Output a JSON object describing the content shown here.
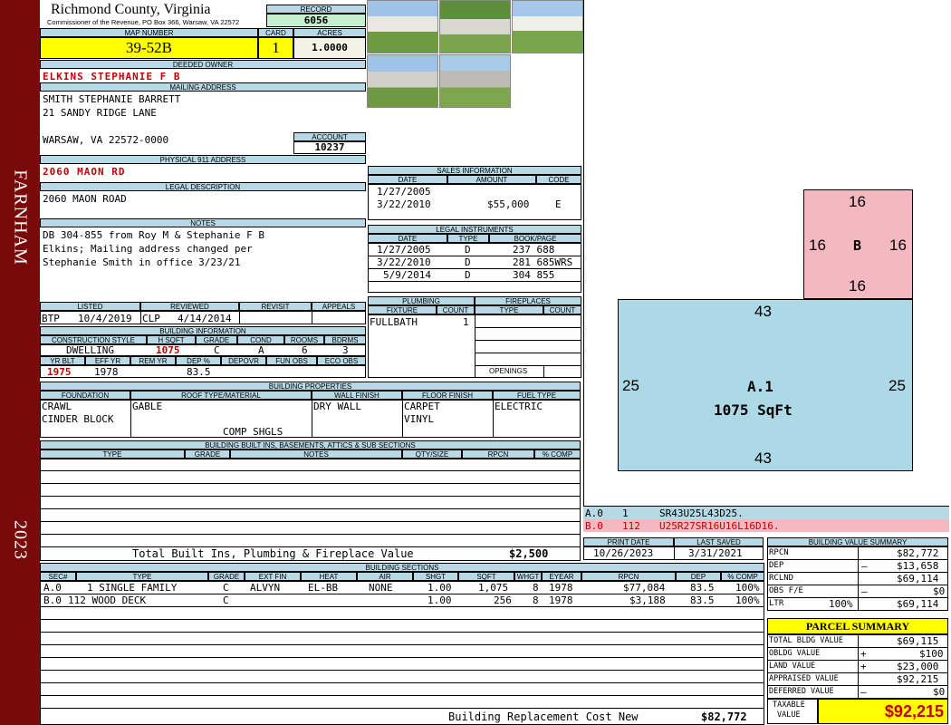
{
  "sidebar": {
    "locality": "FARNHAM",
    "year": "2023"
  },
  "header": {
    "county": "Richmond County, Virginia",
    "commissioner": "Commissioner of the Revenue, PO Box 366, Warsaw, VA 22572",
    "record_label": "RECORD",
    "record": "6056",
    "map_label": "MAP NUMBER",
    "map": "39-52B",
    "card_label": "CARD",
    "card": "1",
    "acres_label": "ACRES",
    "acres": "1.0000"
  },
  "owner": {
    "label": "DEEDED OWNER",
    "name": "ELKINS STEPHANIE F B",
    "mail_label": "MAILING ADDRESS",
    "mail1": "SMITH STEPHANIE BARRETT",
    "mail2": "21 SANDY RIDGE LANE",
    "mail3": "WARSAW, VA 22572-0000",
    "account_label": "ACCOUNT",
    "account": "10237"
  },
  "physical": {
    "label": "PHYSICAL 911 ADDRESS",
    "value": "2060 MAON RD"
  },
  "legal": {
    "label": "LEGAL DESCRIPTION",
    "value": "2060 MAON ROAD"
  },
  "notes": {
    "label": "NOTES",
    "line1": "DB 304-855 from Roy M & Stephanie F B",
    "line2": "Elkins; Mailing address changed per",
    "line3": "Stephanie Smith in office 3/23/21"
  },
  "review": {
    "listed_label": "LISTED",
    "reviewed_label": "REVIEWED",
    "revisit_label": "REVISIT",
    "appeals_label": "APPEALS",
    "listed_by": "BTP",
    "listed_date": "10/4/2019",
    "reviewed_by": "CLP",
    "reviewed_date": "4/14/2014"
  },
  "building": {
    "label": "BUILDING INFORMATION",
    "h_style": "CONSTRUCTION STYLE",
    "h_sqft": "H SQFT",
    "h_grade": "GRADE",
    "h_cond": "COND",
    "h_rooms": "ROOMS",
    "h_bdrms": "BDRMS",
    "style": "DWELLING",
    "sqft": "1075",
    "grade": "C",
    "cond": "A",
    "rooms": "6",
    "bdrms": "3",
    "h_yrblt": "YR BLT",
    "h_effyr": "EFF YR",
    "h_remyr": "REM YR",
    "h_dep": "DEP %",
    "h_depovr": "DEPOVR",
    "h_funobs": "FUN OBS",
    "h_ecoobs": "ECO OBS",
    "yrblt": "1975",
    "effyr": "1978",
    "dep": "83.5"
  },
  "props": {
    "label": "BUILDING PROPERTIES",
    "h_found": "FOUNDATION",
    "h_roof": "ROOF TYPE/MATERIAL",
    "h_wall": "WALL FINISH",
    "h_floor": "FLOOR FINISH",
    "h_fuel": "FUEL TYPE",
    "found1": "CRAWL",
    "found2": "CINDER BLOCK",
    "roof1": "GABLE",
    "roof2": "COMP SHGLS",
    "wall": "DRY WALL",
    "floor1": "CARPET",
    "floor2": "VINYL",
    "fuel": "ELECTRIC"
  },
  "sales": {
    "label": "SALES INFORMATION",
    "h_date": "DATE",
    "h_amount": "AMOUNT",
    "h_code": "CODE",
    "rows": [
      {
        "date": "1/27/2005",
        "amount": "",
        "code": ""
      },
      {
        "date": "3/22/2010",
        "amount": "$55,000",
        "code": "E"
      }
    ]
  },
  "instruments": {
    "label": "LEGAL INSTRUMENTS",
    "h_date": "DATE",
    "h_type": "TYPE",
    "h_book": "BOOK/PAGE",
    "rows": [
      {
        "date": "1/27/2005",
        "type": "D",
        "book": "237 688"
      },
      {
        "date": "3/22/2010",
        "type": "D",
        "book": "281 685WRS"
      },
      {
        "date": "5/9/2014",
        "type": "D",
        "book": "304 855"
      }
    ]
  },
  "plumbing": {
    "label": "PLUMBING",
    "h_fixture": "FIXTURE",
    "h_count": "COUNT",
    "fixture": "FULLBATH",
    "count": "1"
  },
  "fireplaces": {
    "label": "FIREPLACES",
    "h_type": "TYPE",
    "h_count": "COUNT",
    "openings": "OPENINGS"
  },
  "builtins": {
    "label": "BUILDING BUILT INS, BASEMENTS, ATTICS & SUB SECTIONS",
    "h_type": "TYPE",
    "h_grade": "GRADE",
    "h_notes": "NOTES",
    "h_qty": "QTY/SIZE",
    "h_rpcn": "RPCN",
    "h_comp": "% COMP",
    "total_label": "Total Built Ins, Plumbing & Fireplace Value",
    "total": "$2,500"
  },
  "dates": {
    "print_label": "PRINT DATE",
    "saved_label": "LAST SAVED",
    "print": "10/26/2023",
    "saved": "3/31/2021"
  },
  "sketch": {
    "b_top": "16",
    "b_left": "16",
    "b_label": "B",
    "b_right": "16",
    "b_bottom": "16",
    "a_top": "43",
    "a_left": "25",
    "a_label": "A.1",
    "a_area": "1075 SqFt",
    "a_right": "25",
    "a_bottom": "43",
    "legend": [
      {
        "id": "A.0",
        "n": "1",
        "code": "SR43U25L43D25."
      },
      {
        "id": "B.0",
        "n": "112",
        "code": "U25R27SR16U16L16D16."
      }
    ]
  },
  "sections": {
    "label": "BUILDING SECTIONS",
    "h_sec": "SEC#",
    "h_type": "TYPE",
    "h_grade": "GRADE",
    "h_ext": "EXT FIN",
    "h_heat": "HEAT",
    "h_air": "AIR",
    "h_shgt": "SHGT",
    "h_sqft": "SQFT",
    "h_whgt": "WHGT",
    "h_eyear": "EYEAR",
    "h_rpcn": "RPCN",
    "h_dep": "DEP",
    "h_comp": "% COMP",
    "rows": [
      {
        "sec": "A.0",
        "type": "1 SINGLE FAMILY",
        "grade": "C",
        "ext": "ALVYN",
        "heat": "EL-BB",
        "air": "NONE",
        "shgt": "1.00",
        "sqft": "1,075",
        "whgt": "8",
        "eyear": "1978",
        "rpcn": "$77,084",
        "dep": "83.5",
        "comp": "100%"
      },
      {
        "sec": "B.0",
        "type": "112 WOOD DECK",
        "grade": "C",
        "ext": "",
        "heat": "",
        "air": "",
        "shgt": "1.00",
        "sqft": "256",
        "whgt": "8",
        "eyear": "1978",
        "rpcn": "$3,188",
        "dep": "83.5",
        "comp": "100%"
      }
    ],
    "total_label": "Building Replacement Cost New",
    "total": "$82,772"
  },
  "bvs": {
    "label": "BUILDING VALUE SUMMARY",
    "rpcn_l": "RPCN",
    "rpcn": "$82,772",
    "dep_l": "DEP",
    "dep_s": "–",
    "dep": "$13,658",
    "rclnd_l": "RCLND",
    "rclnd": "$69,114",
    "obs_l": "OBS F/E",
    "obs_s": "–",
    "obs": "$0",
    "ltr_l": "LTR",
    "ltr_p": "100%",
    "ltr": "$69,114"
  },
  "parcel": {
    "label": "PARCEL SUMMARY",
    "bldg_l": "TOTAL BLDG VALUE",
    "bldg": "$69,115",
    "obldg_l": "OBLDG VALUE",
    "obldg_s": "+",
    "obldg": "$100",
    "land_l": "LAND VALUE",
    "land_s": "+",
    "land": "$23,000",
    "appr_l": "APPRAISED VALUE",
    "appr": "$92,215",
    "def_l": "DEFERRED VALUE",
    "def_s": "–",
    "def": "$0",
    "tax_l1": "TAXABLE",
    "tax_l2": "VALUE",
    "tax": "$92,215"
  }
}
